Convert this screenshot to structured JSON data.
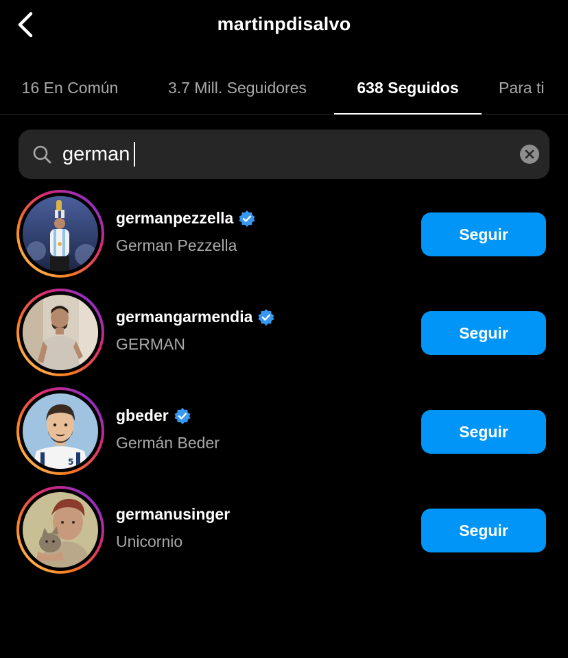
{
  "header": {
    "title": "martinpdisalvo",
    "back_icon": "chevron-left-icon"
  },
  "tabs": [
    {
      "label": "16 En Común",
      "active": false
    },
    {
      "label": "3.7 Mill. Seguidores",
      "active": false
    },
    {
      "label": "638 Seguidos",
      "active": true
    },
    {
      "label": "Para ti",
      "active": false
    }
  ],
  "search": {
    "value": "german",
    "icon": "search-icon",
    "clear_icon": "clear-icon"
  },
  "results": [
    {
      "username": "germanpezzella",
      "full_name": "German Pezzella",
      "verified": true,
      "button_label": "Seguir"
    },
    {
      "username": "germangarmendia",
      "full_name": "GERMAN",
      "verified": true,
      "button_label": "Seguir"
    },
    {
      "username": "gbeder",
      "full_name": "Germán Beder",
      "verified": true,
      "button_label": "Seguir"
    },
    {
      "username": "germanusinger",
      "full_name": "Unicornio",
      "verified": false,
      "button_label": "Seguir"
    }
  ],
  "colors": {
    "background": "#000000",
    "accent_button": "#0095f6",
    "verified_badge": "#3897f0",
    "secondary_text": "#a8a8a8",
    "search_field": "#262626"
  }
}
